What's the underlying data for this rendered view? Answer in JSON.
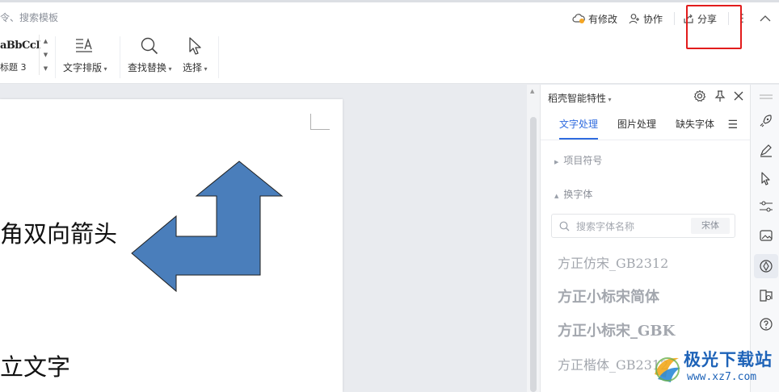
{
  "ribbon": {
    "search_hint": "令、搜索模板",
    "actions": {
      "modified": "有修改",
      "collab": "协作",
      "share": "分享"
    },
    "style_gallery": {
      "sample": "aBbCcI",
      "name": "标题 3"
    },
    "tools": {
      "text_layout": "文字排版",
      "find_replace": "查找替换",
      "select": "选择"
    }
  },
  "document": {
    "line1": "角双向箭头",
    "line2": "立文字"
  },
  "panel": {
    "title": "稻壳智能特性",
    "tabs": [
      "文字处理",
      "图片处理",
      "缺失字体"
    ],
    "active_tab": "文字处理",
    "sections": {
      "bullets": "项目符号",
      "change_font": "换字体"
    },
    "search_placeholder": "搜索字体名称",
    "font_tag": "宋体",
    "fonts": [
      "方正仿宋_GB2312",
      "方正小标宋简体",
      "方正小标宋_GBK",
      "方正楷体_GB2312"
    ]
  },
  "watermark": {
    "title": "极光下载站",
    "url": "www.xz7.com"
  },
  "colors": {
    "accent": "#2f6bdf",
    "shape_fill": "#4a7ebb",
    "highlight": "#e21c1c"
  },
  "icons": [
    "share-icon",
    "collab-icon",
    "cloud-icon",
    "settings-icon",
    "pin-icon",
    "close-icon",
    "rocket-icon",
    "pen-icon",
    "cursor-icon",
    "sliders-icon",
    "image-icon",
    "ai-icon",
    "book-icon",
    "help-icon"
  ]
}
